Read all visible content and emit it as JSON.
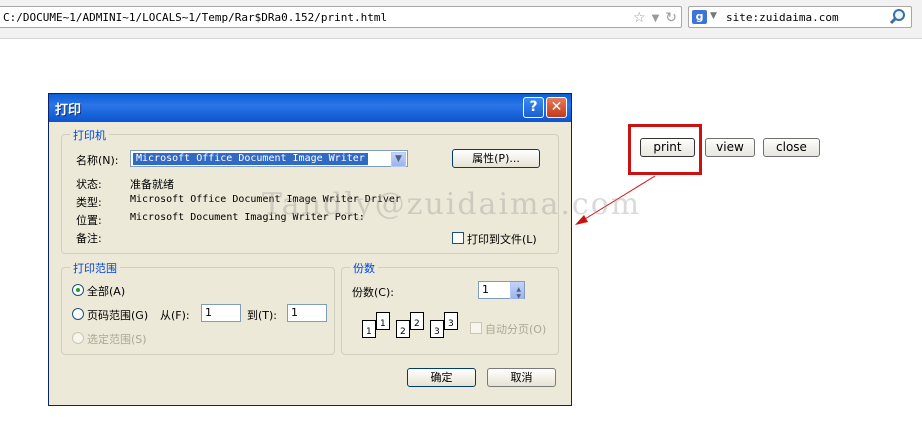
{
  "browser": {
    "address": "C:/DOCUME~1/ADMINI~1/LOCALS~1/Temp/Rar$DRa0.152/print.html",
    "search_query": "site:zuidaima.com",
    "search_engine_glyph": "g",
    "icons": [
      "star-icon",
      "dropdown-icon",
      "reload-icon",
      "google-icon",
      "magnifier-icon"
    ]
  },
  "dialog": {
    "title": "打印",
    "help_glyph": "?",
    "close_glyph": "✕",
    "printer_group": {
      "legend": "打印机",
      "name_label": "名称(N):",
      "name_value": "Microsoft Office Document Image Writer",
      "properties_button": "属性(P)...",
      "status_label": "状态:",
      "status_value": "准备就绪",
      "type_label": "类型:",
      "type_value": "Microsoft Office Document Image Writer Driver",
      "where_label": "位置:",
      "where_value": "Microsoft Document Imaging Writer Port:",
      "comment_label": "备注:",
      "print_to_file": "打印到文件(L)"
    },
    "range_group": {
      "legend": "打印范围",
      "all": "全部(A)",
      "pages": "页码范围(G)",
      "from_label": "从(F):",
      "from_value": "1",
      "to_label": "到(T):",
      "to_value": "1",
      "selection": "选定范围(S)"
    },
    "copies_group": {
      "legend": "份数",
      "copies_label": "份数(C):",
      "copies_value": "1",
      "collate": "自动分页(O)",
      "page_numbers": [
        "1",
        "1",
        "2",
        "2",
        "3",
        "3"
      ]
    },
    "ok_button": "确定",
    "cancel_button": "取消"
  },
  "page_buttons": {
    "print": "print",
    "view": "view",
    "close": "close"
  },
  "watermark": "Tandly@zuidaima.com",
  "colors": {
    "title_bar": "#0a5fd8",
    "dialog_bg": "#ece9d8",
    "legend_text": "#0046d5",
    "highlight_box": "#cc1111",
    "arrow": "#cc1111",
    "selection": "#316ac5"
  }
}
